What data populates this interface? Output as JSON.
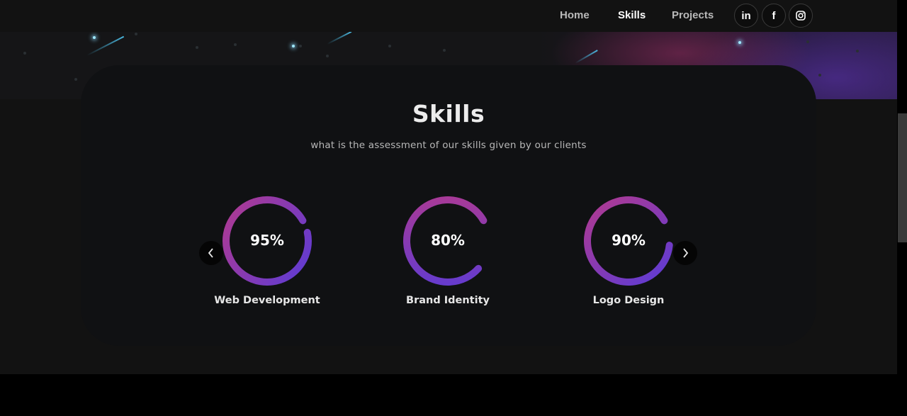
{
  "nav": {
    "links": [
      "Home",
      "Skills",
      "Projects"
    ],
    "active": "Skills",
    "social": {
      "linkedin_label": "in",
      "facebook_label": "f",
      "instagram_icon": "instagram-icon"
    }
  },
  "skills": {
    "title": "Skills",
    "subtitle": "what is the assessment of our skills given by our clients",
    "items": [
      {
        "label": "Web Development",
        "percent_text": "95%",
        "value": 0.95
      },
      {
        "label": "Brand Identity",
        "percent_text": "80%",
        "value": 0.8
      },
      {
        "label": "Logo Design",
        "percent_text": "90%",
        "value": 0.9
      }
    ],
    "prev_icon": "chevron-left-icon",
    "next_icon": "chevron-right-icon"
  },
  "colors": {
    "page_background": "#000000",
    "section_background": "#121212",
    "card_background": "#101113",
    "ring_start": "#b23a8f",
    "ring_end": "#5b3bd6",
    "accent_text": "#ffffff"
  }
}
